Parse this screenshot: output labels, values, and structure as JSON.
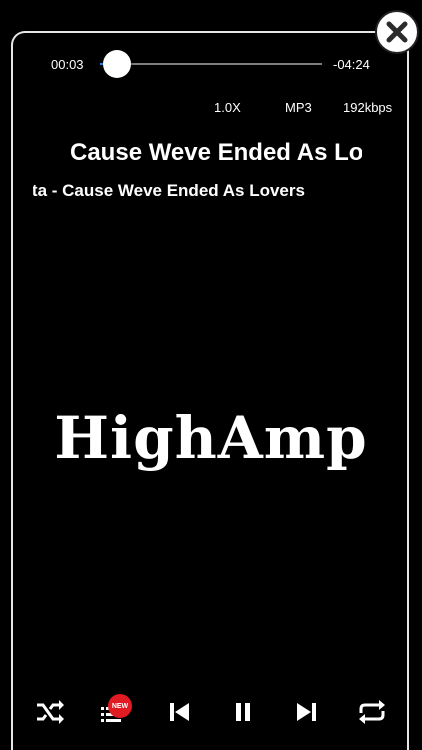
{
  "playback": {
    "elapsed": "00:03",
    "remaining": "-04:24",
    "progress_fraction": 0.012
  },
  "info": {
    "speed": "1.0X",
    "format": "MP3",
    "bitrate": "192kbps"
  },
  "track": {
    "title": "Cause Weve Ended As Lovers",
    "subtitle": "Night / Syreeta - Cause Weve Ended As Lovers"
  },
  "logo_text": "HighAmp",
  "badge_text": "NEW",
  "icons": {
    "close": "close-icon",
    "shuffle": "shuffle-icon",
    "playlist": "playlist-icon",
    "previous": "previous-track-icon",
    "pause": "pause-icon",
    "next": "next-track-icon",
    "repeat": "repeat-icon"
  },
  "colors": {
    "background": "#000000",
    "accent": "#2a8cff",
    "badge": "#e11b22"
  }
}
